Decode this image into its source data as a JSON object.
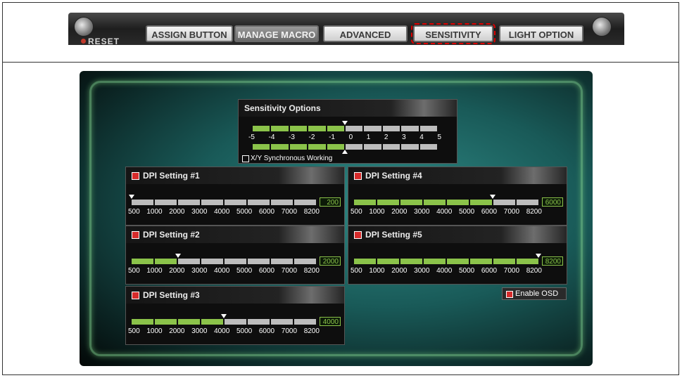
{
  "toolbar": {
    "reset_label": "RESET",
    "tabs": [
      {
        "label": "ASSIGN BUTTON"
      },
      {
        "label": "MANAGE MACRO"
      },
      {
        "label": "ADVANCED"
      },
      {
        "label": "SENSITIVITY"
      },
      {
        "label": "LIGHT OPTION"
      }
    ],
    "active_tab": "MANAGE MACRO",
    "highlighted_tab": "SENSITIVITY"
  },
  "sensitivity": {
    "title": "Sensitivity Options",
    "scale": [
      "-5",
      "-4",
      "-3",
      "-2",
      "-1",
      "0",
      "1",
      "2",
      "3",
      "4",
      "5"
    ],
    "x_value": 0,
    "y_value": 0,
    "sync_label": "X/Y Synchronous Working"
  },
  "dpi_scale": [
    "500",
    "1000",
    "2000",
    "3000",
    "4000",
    "5000",
    "6000",
    "7000",
    "8200"
  ],
  "dpi": [
    {
      "title": "DPI Setting #1",
      "value": "200",
      "level_segments": 0
    },
    {
      "title": "DPI Setting #2",
      "value": "2000",
      "level_segments": 2
    },
    {
      "title": "DPI Setting #3",
      "value": "4000",
      "level_segments": 4
    },
    {
      "title": "DPI Setting #4",
      "value": "6000",
      "level_segments": 6
    },
    {
      "title": "DPI Setting #5",
      "value": "8200",
      "level_segments": 8
    }
  ],
  "osd": {
    "label": "Enable OSD"
  },
  "colors": {
    "accent_green": "#8bc34a",
    "indicator_red": "#d62b2b",
    "highlight_dashed": "#dd0000"
  }
}
